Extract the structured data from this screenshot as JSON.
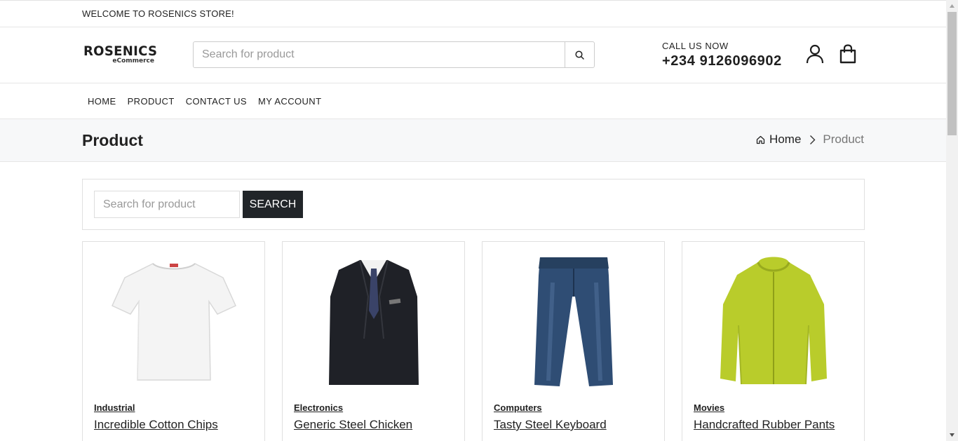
{
  "topbar": {
    "welcome": "WELCOME TO ROSENICS STORE!"
  },
  "header": {
    "logo_main": "ROSENICS",
    "logo_sub": "eCommerce",
    "search_placeholder": "Search for product",
    "call_label": "CALL US NOW",
    "phone": "+234 9126096902",
    "icons": [
      "search-icon",
      "user-icon",
      "shopping-bag-icon"
    ]
  },
  "nav": {
    "items": [
      {
        "label": "HOME"
      },
      {
        "label": "PRODUCT"
      },
      {
        "label": "CONTACT US"
      },
      {
        "label": "MY ACCOUNT"
      }
    ]
  },
  "banner": {
    "title": "Product",
    "breadcrumb_home": "Home",
    "breadcrumb_current": "Product"
  },
  "filter": {
    "placeholder": "Search for product",
    "button_label": "SEARCH"
  },
  "products": [
    {
      "category": "Industrial",
      "name": "Incredible Cotton Chips",
      "image": "white t-shirt"
    },
    {
      "category": "Electronics",
      "name": "Generic Steel Chicken",
      "image": "black suit"
    },
    {
      "category": "Computers",
      "name": "Tasty Steel Keyboard",
      "image": "blue jeans"
    },
    {
      "category": "Movies",
      "name": "Handcrafted Rubber Pants",
      "image": "lime green jacket"
    }
  ],
  "colors": {
    "dark_button": "#212529",
    "banner_bg": "#f7f8f9",
    "border": "#e0e0e0"
  }
}
